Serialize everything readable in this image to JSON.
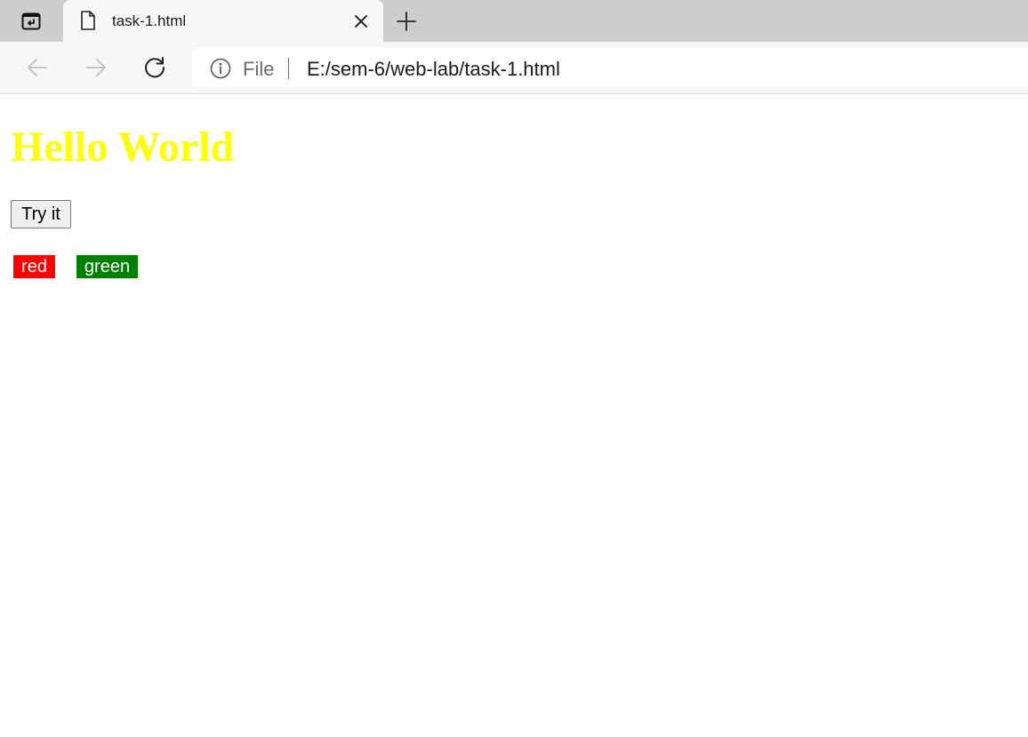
{
  "browser": {
    "tab": {
      "title": "task-1.html",
      "icon": "file-icon"
    },
    "address": {
      "scheme": "File",
      "url": "E:/sem-6/web-lab/task-1.html"
    }
  },
  "page": {
    "heading": "Hello World",
    "heading_color": "#ffff00",
    "button_label": "Try it",
    "labels": [
      {
        "text": "red",
        "color": "#ff0000"
      },
      {
        "text": "green",
        "color": "#008000"
      }
    ]
  }
}
